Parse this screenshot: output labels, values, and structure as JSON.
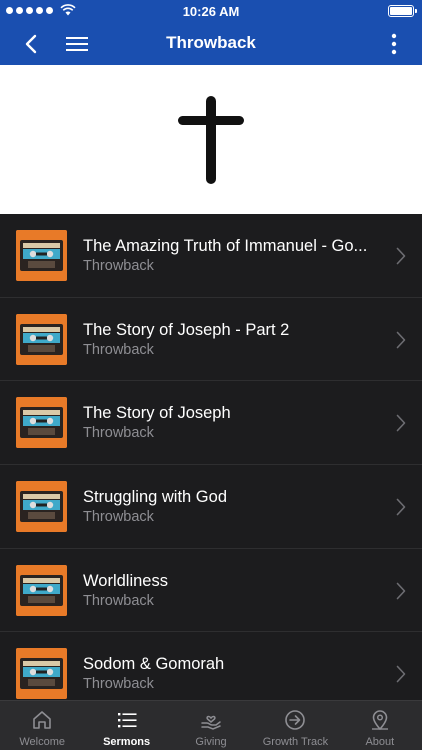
{
  "status_bar": {
    "time": "10:26 AM"
  },
  "nav": {
    "title": "Throwback"
  },
  "sermons": [
    {
      "title": "The Amazing Truth of Immanuel - Go...",
      "series": "Throwback"
    },
    {
      "title": "The Story of Joseph - Part 2",
      "series": "Throwback"
    },
    {
      "title": "The Story of Joseph",
      "series": "Throwback"
    },
    {
      "title": "Struggling with God",
      "series": "Throwback"
    },
    {
      "title": "Worldliness",
      "series": "Throwback"
    },
    {
      "title": "Sodom & Gomorah",
      "series": "Throwback"
    }
  ],
  "tabs": [
    {
      "label": "Welcome",
      "icon": "home-icon",
      "active": false
    },
    {
      "label": "Sermons",
      "icon": "list-icon",
      "active": true
    },
    {
      "label": "Giving",
      "icon": "giving-hand-icon",
      "active": false
    },
    {
      "label": "Growth Track",
      "icon": "arrow-circle-icon",
      "active": false
    },
    {
      "label": "About",
      "icon": "location-pin-icon",
      "active": false
    }
  ],
  "colors": {
    "nav_blue": "#1a4fb0",
    "thumb_orange": "#e87a28",
    "list_bg": "#1c1c1e"
  }
}
